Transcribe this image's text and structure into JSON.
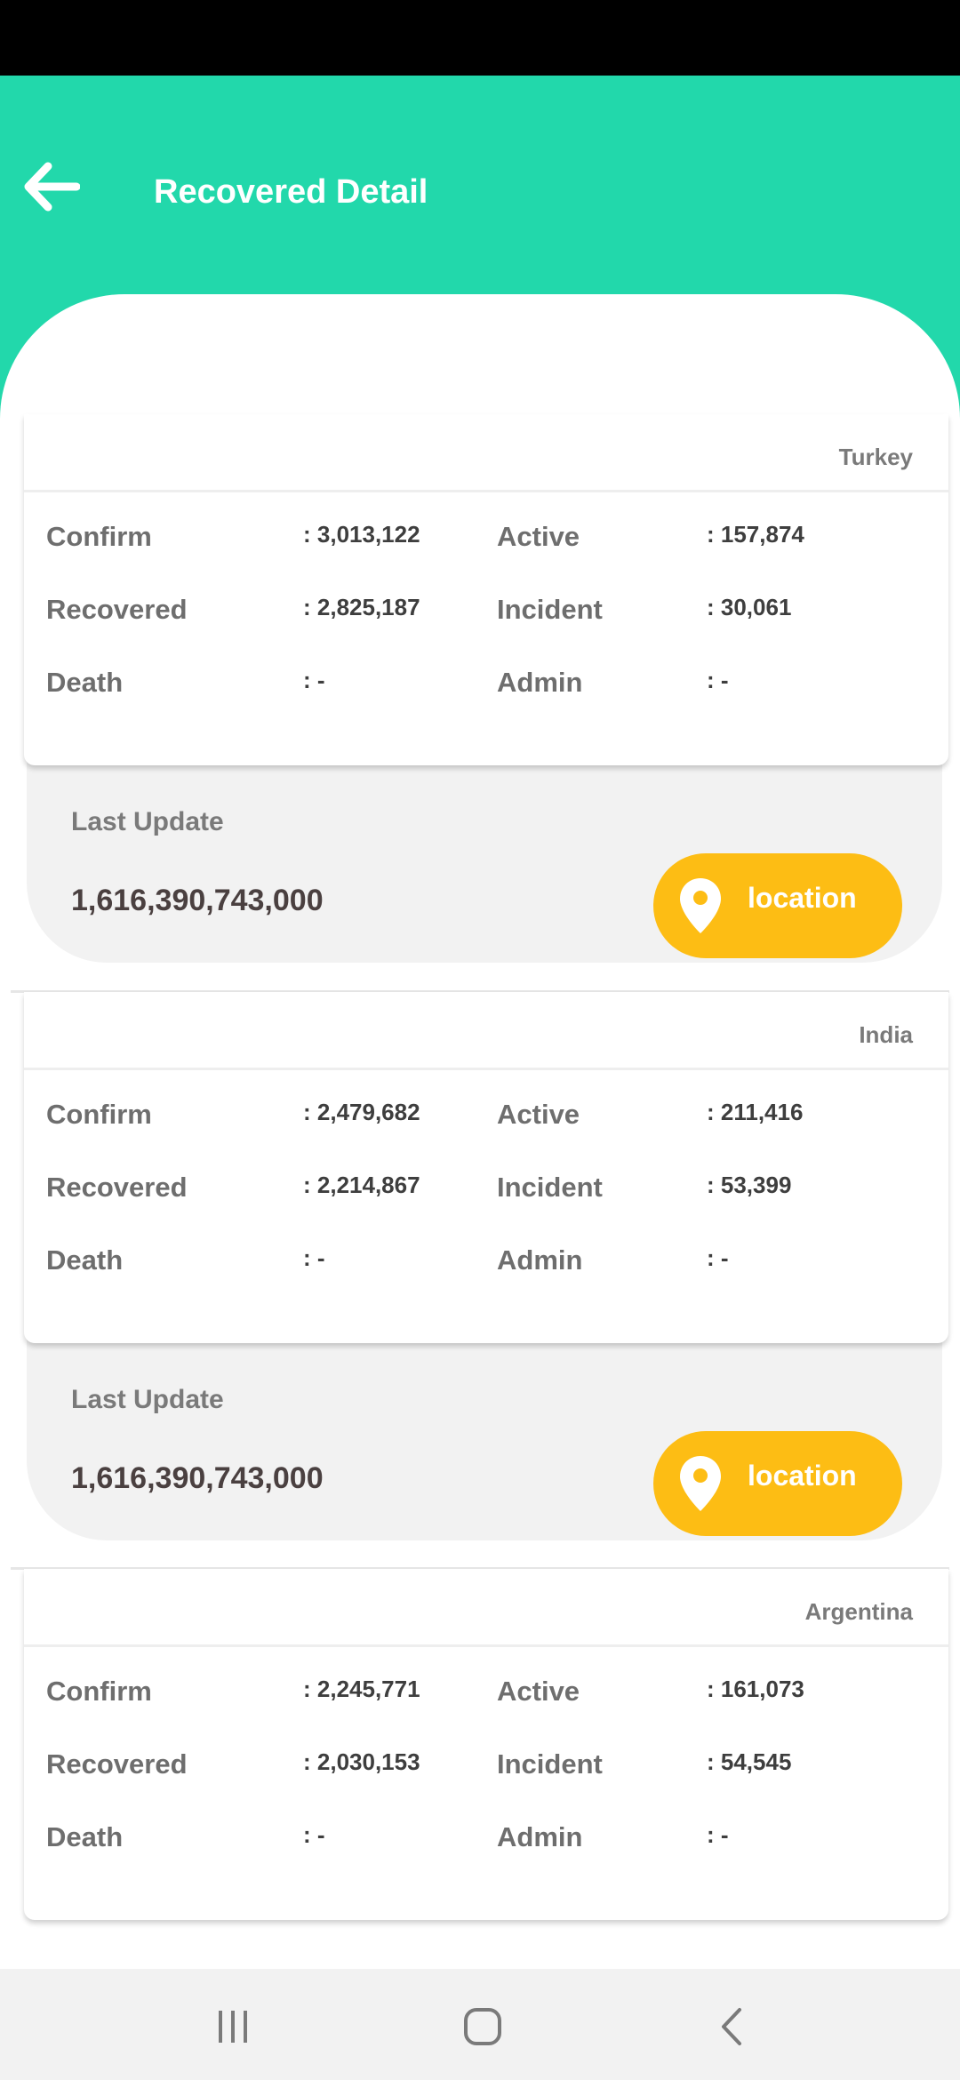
{
  "header": {
    "title": "Recovered Detail"
  },
  "labels": {
    "confirm": "Confirm",
    "recovered": "Recovered",
    "death": "Death",
    "active": "Active",
    "incident": "Incident",
    "admin": "Admin",
    "last_update": "Last Update",
    "location": "location"
  },
  "records": [
    {
      "country": "Turkey",
      "confirm": ": 3,013,122",
      "recovered": ": 2,825,187",
      "death": ": -",
      "active": ": 157,874",
      "incident": ": 30,061",
      "admin": ": -",
      "last_update": "1,616,390,743,000"
    },
    {
      "country": "India",
      "confirm": ": 2,479,682",
      "recovered": ": 2,214,867",
      "death": ": -",
      "active": ": 211,416",
      "incident": ": 53,399",
      "admin": ": -",
      "last_update": "1,616,390,743,000"
    },
    {
      "country": "Argentina",
      "confirm": ": 2,245,771",
      "recovered": ": 2,030,153",
      "death": ": -",
      "active": ": 161,073",
      "incident": ": 54,545",
      "admin": ": -"
    }
  ],
  "icons": {
    "back": "arrow-left-icon",
    "location": "map-pin-icon",
    "nav_recents": "recents-icon",
    "nav_home": "home-icon",
    "nav_back": "chevron-left-icon"
  },
  "colors": {
    "header": "#22d8ab",
    "accent": "#fdbd14",
    "panel": "#f2f2f2"
  }
}
